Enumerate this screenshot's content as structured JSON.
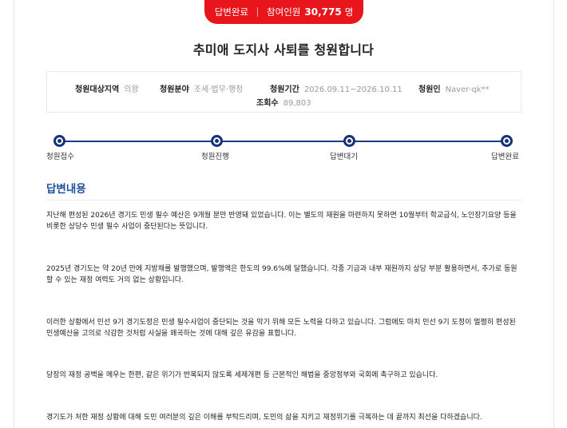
{
  "status": {
    "label": "답변완료",
    "participants_label": "참여인원",
    "participants_count": "30,775",
    "participants_unit": "명"
  },
  "petition": {
    "title": "추미애 도지사 사퇴를 청원합니다",
    "info": {
      "region_label": "청원대상지역",
      "region_value": "의왕",
      "field_label": "청원분야",
      "field_value": "조세·법무·행정",
      "period_label": "청원기간",
      "period_value": "2026.09.11~2026.10.11",
      "petitioner_label": "청원인",
      "petitioner_value": "Naver-qk**",
      "views_label": "조회수",
      "views_value": "89,803"
    }
  },
  "progress": {
    "steps": [
      {
        "label": "청원접수"
      },
      {
        "label": "청원진행"
      },
      {
        "label": "답변대기"
      },
      {
        "label": "답변완료"
      }
    ]
  },
  "answer": {
    "section_title": "답변내용",
    "paragraphs": [
      "지난해 편성된 2026년 경기도 민생 필수 예산은 9개월 분만 반영돼 있었습니다. 이는 별도의 재원을 마련하지 못하면 10월부터 학교급식, 노인장기요양 등을 비롯한 상당수 민생 필수 사업이 중단된다는 뜻입니다.",
      "2025년 경기도는 약 20년 만에 지방채를 발행했으며, 발행액은 한도의 99.6%에 달했습니다. 각종 기금과 내부 재원까지 상당 부분 활용하면서, 추가로 동원할 수 있는 재정 여력도 거의 없는 상황입니다.",
      "이러한 상황에서 민선 9기 경기도정은 민생 필수사업이 중단되는 것을 막기 위해 모든 노력을 다하고 있습니다. 그럼에도 마치 민선 9기 도정이 멀쩡히 편성된 민생예산을 고의로 삭감한 것처럼 사실을 왜곡하는 것에 대해 깊은 유감을 표합니다.",
      "당장의 재정 공백을 메우는 한편, 같은 위기가 반복되지 않도록 세제개편 등 근본적인 해법을 중앙정부와 국회에 촉구하고 있습니다.",
      "경기도가 처한 재정 상황에 대해 도민 여러분의 깊은 이해를 부탁드리며, 도민의 삶을 지키고 재정위기를 극복하는 데 끝까지 최선을 다하겠습니다."
    ]
  },
  "colors": {
    "status_red": "#e8161c",
    "progress_navy": "#16307a",
    "section_blue": "#1d4f9c"
  }
}
